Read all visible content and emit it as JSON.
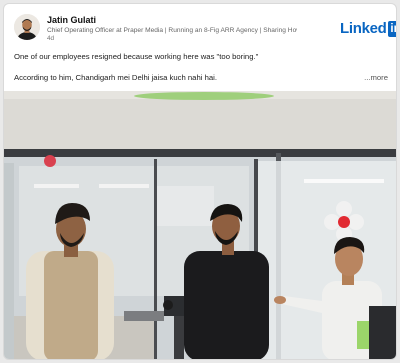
{
  "author": {
    "name": "Jatin Gulati",
    "headline": "Chief Operating Officer at Praper Media | Running an 8-Fig ARR Agency | Sharing How!",
    "time": "4d"
  },
  "brand": {
    "wordmark": "Linked",
    "box_text": "in",
    "color": "#0a66c2"
  },
  "post": {
    "line1": "One of our employees resigned because working here was \"too boring.\"",
    "line2": "According to him, Chandigarh mei Delhi jaisa kuch nahi hai.",
    "more_label": "...more"
  },
  "icons": {
    "logo": "linkedin-logo",
    "avatar": "profile-photo",
    "photo": "office-photo"
  }
}
